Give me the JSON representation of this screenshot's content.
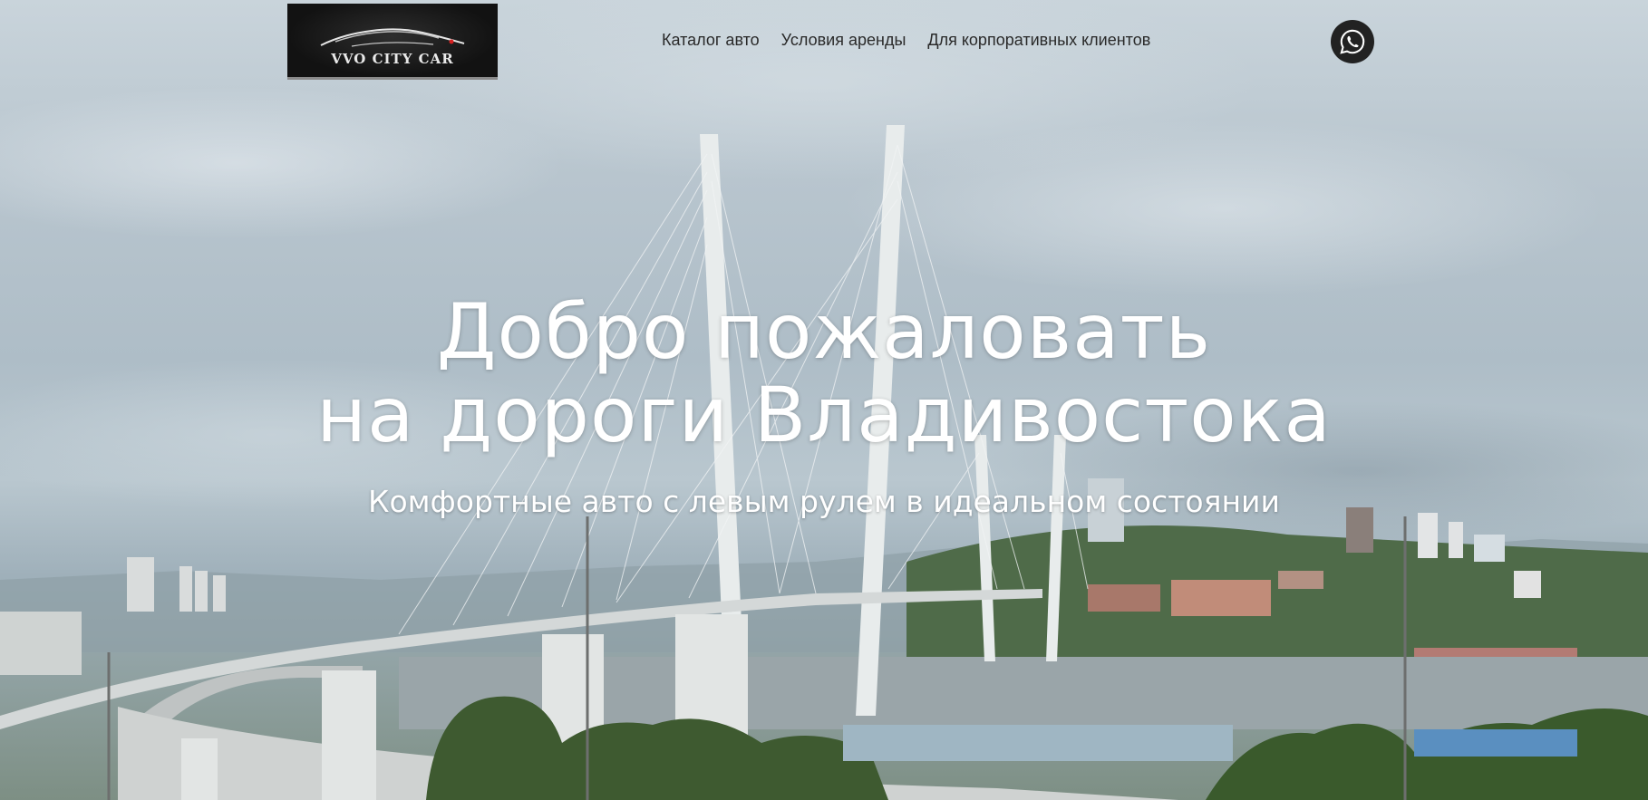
{
  "header": {
    "logo_text": "VVO CITY CAR",
    "nav": [
      {
        "label": "Каталог авто"
      },
      {
        "label": "Условия аренды"
      },
      {
        "label": "Для корпоративных клиентов"
      }
    ],
    "whatsapp_icon": "whatsapp-icon"
  },
  "hero": {
    "title_line1": "Добро пожаловать",
    "title_line2": "на дороги Владивостока",
    "subtitle": "Комфортные авто с левым рулем в идеальном состоянии"
  },
  "colors": {
    "nav_text": "#2a2a2a",
    "hero_text": "#ffffff",
    "whatsapp_bg": "#222222"
  }
}
